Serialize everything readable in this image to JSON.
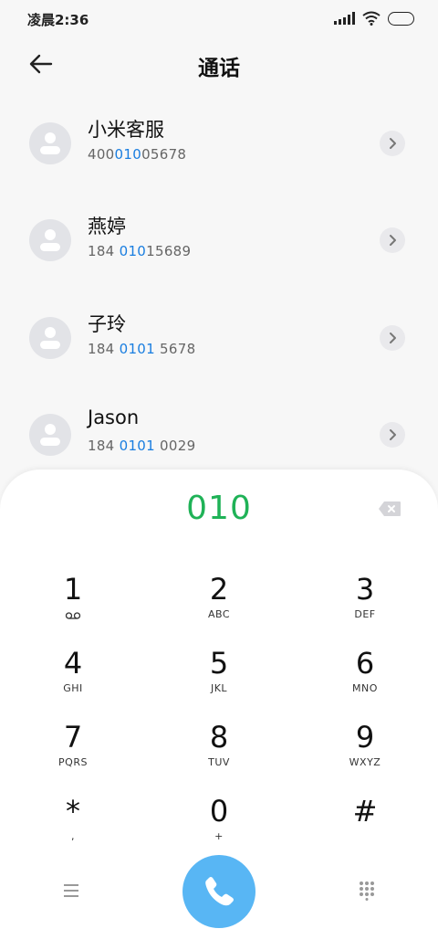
{
  "status_bar": {
    "time": "凌晨2:36"
  },
  "header": {
    "title": "通话"
  },
  "contacts": [
    {
      "name": "小米客服",
      "number_pre": "400",
      "number_hl": "010",
      "number_post": "05678"
    },
    {
      "name": "燕婷",
      "number_pre": "184 ",
      "number_hl": "010",
      "number_post": "15689"
    },
    {
      "name": "子玲",
      "number_pre": "184 ",
      "number_hl": "0101",
      "number_post": " 5678"
    },
    {
      "name": "Jason",
      "number_pre": "184 ",
      "number_hl": "0101",
      "number_post": " 0029"
    }
  ],
  "dialpad": {
    "dialed_number": "010",
    "keys": [
      {
        "digit": "1",
        "letters": ""
      },
      {
        "digit": "2",
        "letters": "ABC"
      },
      {
        "digit": "3",
        "letters": "DEF"
      },
      {
        "digit": "4",
        "letters": "GHI"
      },
      {
        "digit": "5",
        "letters": "JKL"
      },
      {
        "digit": "6",
        "letters": "MNO"
      },
      {
        "digit": "7",
        "letters": "PQRS"
      },
      {
        "digit": "8",
        "letters": "TUV"
      },
      {
        "digit": "9",
        "letters": "WXYZ"
      },
      {
        "digit": "*",
        "letters": ","
      },
      {
        "digit": "0",
        "letters": "+"
      },
      {
        "digit": "#",
        "letters": ""
      }
    ]
  },
  "icons": {
    "back": "back-arrow-icon",
    "chevron": "chevron-right-icon",
    "backspace": "backspace-icon",
    "voicemail": "voicemail-icon",
    "menu": "menu-icon",
    "call": "phone-icon",
    "dialpad_toggle": "dialpad-icon"
  },
  "colors": {
    "dialed_number": "#1fb257",
    "number_highlight": "#1a7ee0",
    "call_button": "#58b6f4",
    "avatar_bg": "#e2e3e7"
  }
}
